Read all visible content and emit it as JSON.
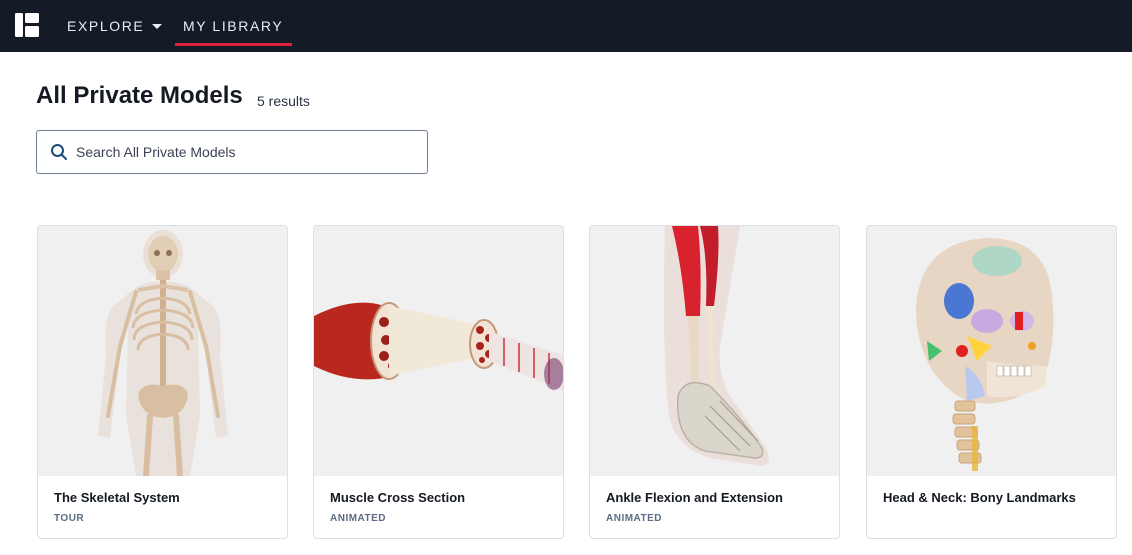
{
  "nav": {
    "logo_icon": "brand-logo-icon",
    "explore_label": "EXPLORE",
    "library_label": "MY LIBRARY",
    "active_accent": "#e0223b",
    "background": "#151b26"
  },
  "header": {
    "title": "All Private Models",
    "result_count": "5 results"
  },
  "search": {
    "placeholder": "Search All Private Models",
    "value": "",
    "icon": "search-icon"
  },
  "models": [
    {
      "title": "The Skeletal System",
      "tag": "TOUR",
      "thumbnail": "skeleton-image"
    },
    {
      "title": "Muscle Cross Section",
      "tag": "ANIMATED",
      "thumbnail": "muscle-image"
    },
    {
      "title": "Ankle Flexion and Extension",
      "tag": "ANIMATED",
      "thumbnail": "leg-image"
    },
    {
      "title": "Head & Neck: Bony Landmarks",
      "tag": "",
      "thumbnail": "skull-image"
    }
  ]
}
